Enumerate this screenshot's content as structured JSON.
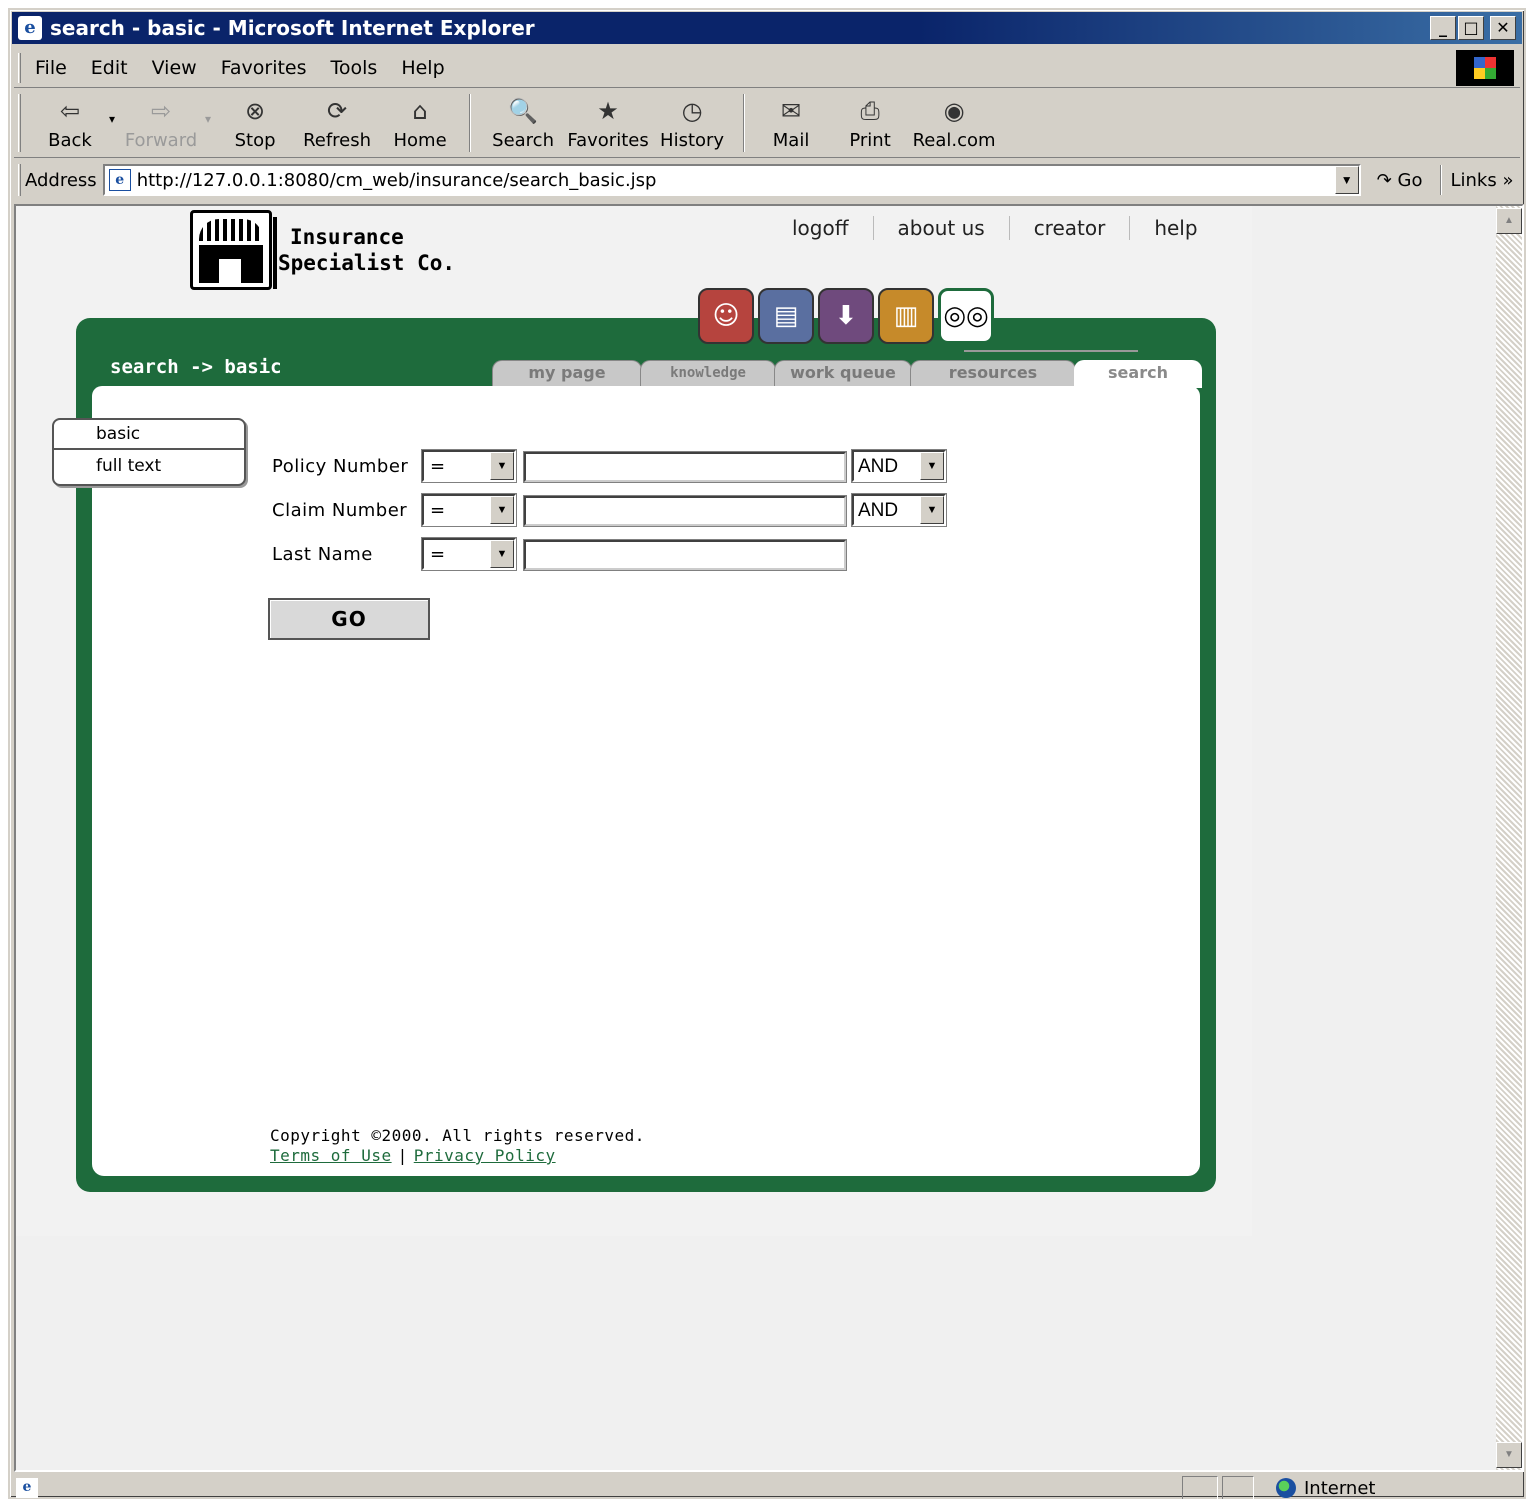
{
  "window": {
    "title": "search - basic - Microsoft Internet Explorer",
    "app_icon": "e",
    "controls": {
      "minimize": "_",
      "maximize": "□",
      "close": "✕"
    }
  },
  "menubar": {
    "items": [
      {
        "label": "File"
      },
      {
        "label": "Edit"
      },
      {
        "label": "View"
      },
      {
        "label": "Favorites"
      },
      {
        "label": "Tools"
      },
      {
        "label": "Help"
      }
    ]
  },
  "toolbar": {
    "back": {
      "label": "Back",
      "icon": "⇦"
    },
    "forward": {
      "label": "Forward",
      "icon": "⇨"
    },
    "stop": {
      "label": "Stop",
      "icon": "⊗"
    },
    "refresh": {
      "label": "Refresh",
      "icon": "⟳"
    },
    "home": {
      "label": "Home",
      "icon": "⌂"
    },
    "search": {
      "label": "Search",
      "icon": "🔍"
    },
    "favorites": {
      "label": "Favorites",
      "icon": "★"
    },
    "history": {
      "label": "History",
      "icon": "◷"
    },
    "mail": {
      "label": "Mail",
      "icon": "✉"
    },
    "print": {
      "label": "Print",
      "icon": "⎙"
    },
    "realcom": {
      "label": "Real.com",
      "icon": "◉"
    },
    "dropdown_glyph": "▾"
  },
  "addressbar": {
    "label": "Address",
    "url": "http://127.0.0.1:8080/cm_web/insurance/search_basic.jsp",
    "go_label": "Go",
    "go_icon": "↷",
    "links_label": "Links »",
    "dropdown_glyph": "▼"
  },
  "site": {
    "company_line1": "Insurance",
    "company_line2": "Specialist Co.",
    "top_links": [
      {
        "label": "logoff"
      },
      {
        "label": "about us"
      },
      {
        "label": "creator"
      },
      {
        "label": "help"
      }
    ],
    "tab_icons": [
      {
        "name": "my-page-face-icon",
        "glyph": "☺"
      },
      {
        "name": "knowledge-document-icon",
        "glyph": "▤"
      },
      {
        "name": "work-queue-inbox-icon",
        "glyph": "⬇"
      },
      {
        "name": "resources-books-icon",
        "glyph": "▥"
      },
      {
        "name": "search-binoculars-icon",
        "glyph": "◎◎"
      }
    ],
    "breadcrumb": "search -> basic",
    "nav_tabs": [
      {
        "label": "my page"
      },
      {
        "label": "knowledge center"
      },
      {
        "label": "work queue"
      },
      {
        "label": "resources"
      },
      {
        "label": "search"
      }
    ],
    "subnav": [
      {
        "label": "basic"
      },
      {
        "label": "full text"
      }
    ],
    "form": {
      "rows": [
        {
          "label": "Policy Number",
          "operator": "=",
          "value": "",
          "conjunction": "AND"
        },
        {
          "label": "Claim Number",
          "operator": "=",
          "value": "",
          "conjunction": "AND"
        },
        {
          "label": "Last Name",
          "operator": "=",
          "value": ""
        }
      ],
      "submit_label": "GO",
      "dropdown_glyph": "▼"
    },
    "footer": {
      "copyright": "Copyright ©2000. All rights reserved.",
      "terms_label": "Terms of Use",
      "separator": "|",
      "privacy_label": "Privacy Policy"
    },
    "colors": {
      "brand_green": "#1e6b3c",
      "my_page_red": "#b6443e",
      "knowledge_blue": "#5a6fa0",
      "work_queue_purple": "#6f4a7d",
      "resources_gold": "#c68a2a"
    }
  },
  "scrollbar": {
    "up_glyph": "▲",
    "down_glyph": "▼"
  },
  "statusbar": {
    "page_icon": "e",
    "zone_label": "Internet"
  }
}
